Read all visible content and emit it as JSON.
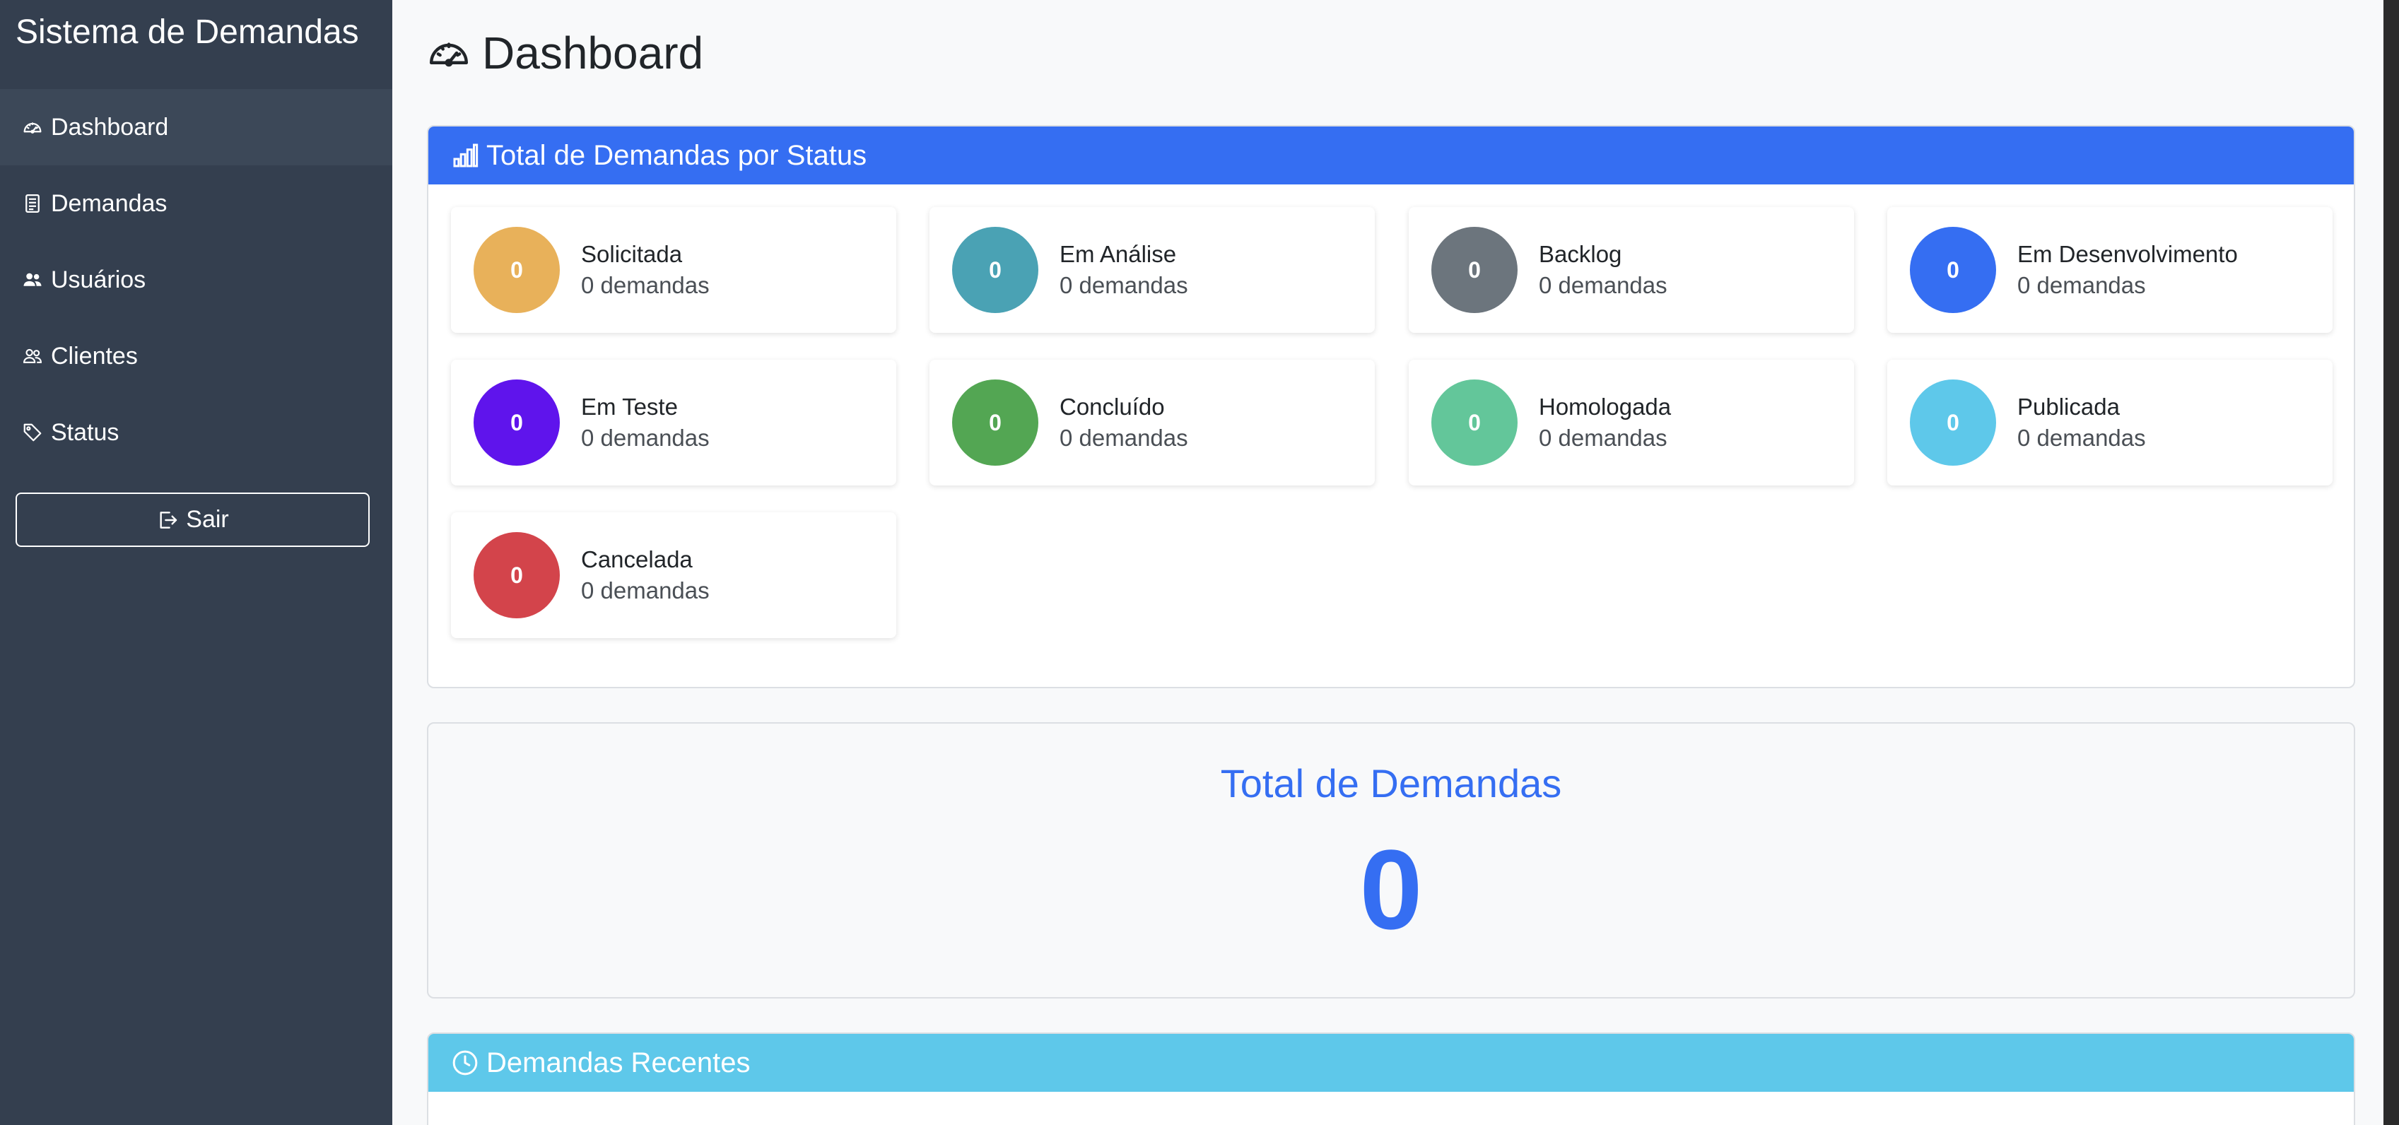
{
  "sidebar": {
    "title": "Sistema de Demandas",
    "items": [
      {
        "label": "Dashboard",
        "icon": "speedometer-icon"
      },
      {
        "label": "Demandas",
        "icon": "document-icon"
      },
      {
        "label": "Usuários",
        "icon": "users-icon"
      },
      {
        "label": "Clientes",
        "icon": "people-icon"
      },
      {
        "label": "Status",
        "icon": "tag-icon"
      }
    ],
    "logout_label": "Sair"
  },
  "page": {
    "title": "Dashboard"
  },
  "status_panel": {
    "header": "Total de Demandas por Status",
    "tiles": [
      {
        "name": "Solicitada",
        "count": "0",
        "count_text": "0 demandas",
        "color": "#e8b15a"
      },
      {
        "name": "Em Análise",
        "count": "0",
        "count_text": "0 demandas",
        "color": "#4aa2b4"
      },
      {
        "name": "Backlog",
        "count": "0",
        "count_text": "0 demandas",
        "color": "#6c757d"
      },
      {
        "name": "Em Desenvolvimento",
        "count": "0",
        "count_text": "0 demandas",
        "color": "#356ef2"
      },
      {
        "name": "Em Teste",
        "count": "0",
        "count_text": "0 demandas",
        "color": "#5f14ec"
      },
      {
        "name": "Concluído",
        "count": "0",
        "count_text": "0 demandas",
        "color": "#53a653"
      },
      {
        "name": "Homologada",
        "count": "0",
        "count_text": "0 demandas",
        "color": "#63c69a"
      },
      {
        "name": "Publicada",
        "count": "0",
        "count_text": "0 demandas",
        "color": "#5ec8ea"
      },
      {
        "name": "Cancelada",
        "count": "0",
        "count_text": "0 demandas",
        "color": "#d3444b"
      }
    ]
  },
  "total_panel": {
    "title": "Total de Demandas",
    "value": "0"
  },
  "recent_panel": {
    "header": "Demandas Recentes"
  }
}
